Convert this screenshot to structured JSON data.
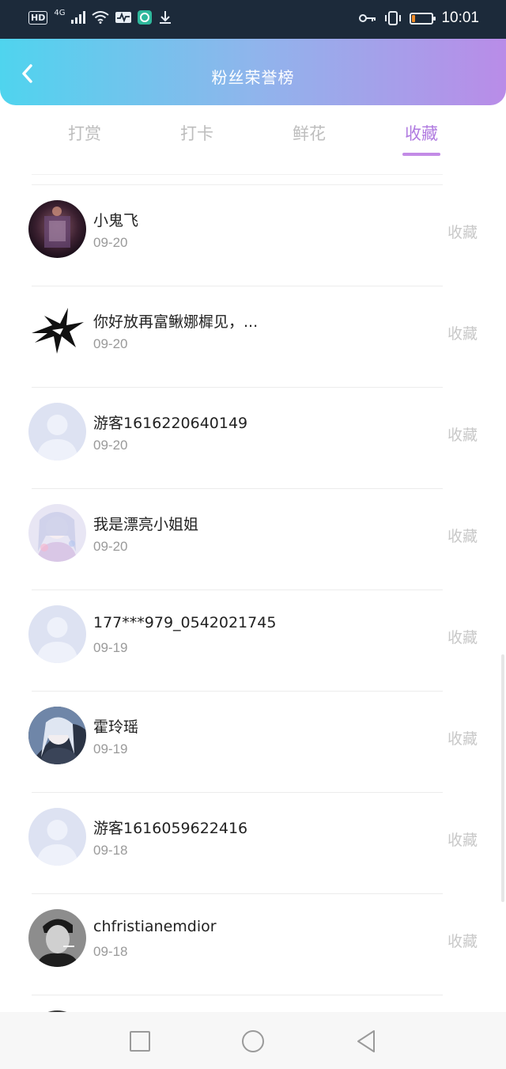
{
  "status_bar": {
    "left_icons": [
      "hd-icon",
      "signal-4g-icon",
      "wifi-icon",
      "activity-icon",
      "browser-icon",
      "download-icon"
    ],
    "hd_label": "HD",
    "net_label": "4G",
    "time": "10:01",
    "battery_level": 0.18
  },
  "header": {
    "title": "粉丝荣誉榜",
    "back_icon": "chevron-left-icon"
  },
  "tabs": [
    {
      "label": "打赏",
      "active": false
    },
    {
      "label": "打卡",
      "active": false
    },
    {
      "label": "鲜花",
      "active": false
    },
    {
      "label": "收藏",
      "active": true
    }
  ],
  "colors": {
    "accent": "#b07be0",
    "header_gradient": [
      "#4fd4ee",
      "#b98ce8"
    ],
    "inactive_text": "#bdbdbd"
  },
  "list": [
    {
      "name": "小鬼飞",
      "date": "09-20",
      "action": "收藏",
      "avatar": "photo-dark"
    },
    {
      "name": "你好放再富鳅娜樨见，...",
      "date": "09-20",
      "action": "收藏",
      "avatar": "tribal-logo"
    },
    {
      "name": "游客1616220640149",
      "date": "09-20",
      "action": "收藏",
      "avatar": "default-user"
    },
    {
      "name": "我是漂亮小姐姐",
      "date": "09-20",
      "action": "收藏",
      "avatar": "anime-girl-light"
    },
    {
      "name": "177***979_0542021745",
      "date": "09-19",
      "action": "收藏",
      "avatar": "default-user"
    },
    {
      "name": "霍玲瑶",
      "date": "09-19",
      "action": "收藏",
      "avatar": "anime-girl-dark"
    },
    {
      "name": "游客1616059622416",
      "date": "09-18",
      "action": "收藏",
      "avatar": "default-user"
    },
    {
      "name": "chfristianemdior",
      "date": "09-18",
      "action": "收藏",
      "avatar": "bw-portrait"
    }
  ],
  "nav_bar": {
    "buttons": [
      "recent-apps-icon",
      "home-icon",
      "back-triangle-icon"
    ]
  }
}
